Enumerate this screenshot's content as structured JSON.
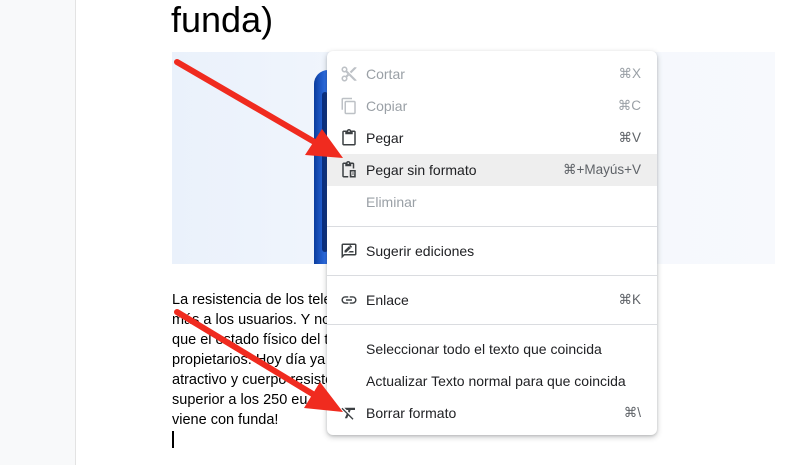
{
  "document": {
    "heading_fragment": "funda)",
    "paragraph_lines": [
      "La resistencia de los tele                                                                    eocupa cada vez",
      "más a los usuarios. Y no                                                                  os actuales hace",
      "que el estado físico del t                                                                   de sus",
      "propietarios. Hoy día ya                                                                    móvil con diseño",
      "atractivo y cuerpo resiste                                                                  precio no",
      "superior a los 250 eu                                                                  ntes. ¡Y además",
      "viene con funda!"
    ]
  },
  "context_menu": {
    "items": [
      {
        "icon": "scissors-icon",
        "label": "Cortar",
        "shortcut": "⌘X",
        "disabled": true
      },
      {
        "icon": "copy-icon",
        "label": "Copiar",
        "shortcut": "⌘C",
        "disabled": true
      },
      {
        "icon": "clipboard-icon",
        "label": "Pegar",
        "shortcut": "⌘V",
        "disabled": false
      },
      {
        "icon": "paste-plain-icon",
        "label": "Pegar sin formato",
        "shortcut": "⌘+Mayús+V",
        "disabled": false,
        "highlighted": true
      },
      {
        "icon": "",
        "label": "Eliminar",
        "shortcut": "",
        "disabled": true
      },
      {
        "icon": "suggest-edit-icon",
        "label": "Sugerir ediciones",
        "shortcut": "",
        "disabled": false
      },
      {
        "icon": "link-icon",
        "label": "Enlace",
        "shortcut": "⌘K",
        "disabled": false
      },
      {
        "icon": "",
        "label": "Seleccionar todo el texto que coincida",
        "shortcut": "",
        "disabled": false
      },
      {
        "icon": "",
        "label": "Actualizar Texto normal para que coincida",
        "shortcut": "",
        "disabled": false
      },
      {
        "icon": "clear-format-icon",
        "label": "Borrar formato",
        "shortcut": "⌘\\",
        "disabled": false
      }
    ]
  },
  "annotations": {
    "arrow_color": "#f02b1f"
  }
}
